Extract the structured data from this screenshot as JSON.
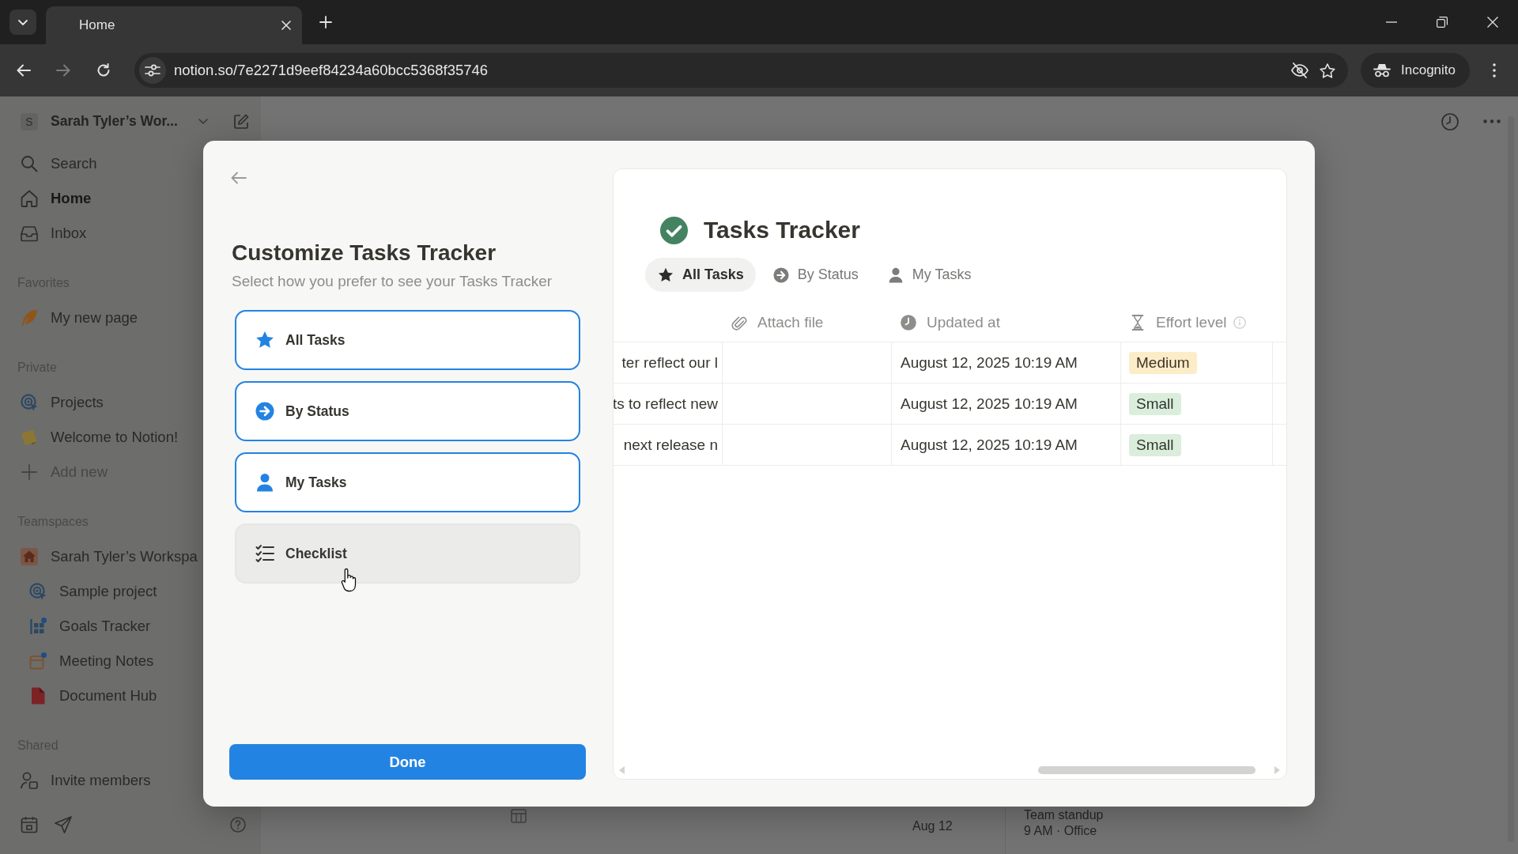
{
  "browser": {
    "tab": {
      "title": "Home"
    },
    "address": "notion.so/7e2271d9eef84234a60bcc5368f35746",
    "profile": "Incognito"
  },
  "sidebar": {
    "workspace": {
      "initial": "S",
      "name": "Sarah Tyler’s Wor..."
    },
    "nav": [
      {
        "label": "Search",
        "kind": "search",
        "selected": false
      },
      {
        "label": "Home",
        "kind": "home",
        "selected": true
      },
      {
        "label": "Inbox",
        "kind": "inbox",
        "selected": false
      }
    ],
    "sections": [
      {
        "title": "Favorites",
        "items": [
          {
            "label": "My new page",
            "kind": "feather"
          }
        ]
      },
      {
        "title": "Private",
        "items": [
          {
            "label": "Projects",
            "kind": "target"
          },
          {
            "label": "Welcome to Notion!",
            "kind": "note"
          },
          {
            "label": "Add new",
            "kind": "add"
          }
        ]
      },
      {
        "title": "Teamspaces",
        "items": [
          {
            "label": "Sarah Tyler’s Workspa",
            "kind": "house",
            "children": [
              {
                "label": "Sample project",
                "kind": "target"
              },
              {
                "label": "Goals Tracker",
                "kind": "grid"
              },
              {
                "label": "Meeting Notes",
                "kind": "calendar"
              },
              {
                "label": "Document Hub",
                "kind": "document"
              }
            ]
          }
        ]
      },
      {
        "title": "Shared",
        "items": [
          {
            "label": "Invite members",
            "kind": "invite"
          }
        ]
      }
    ]
  },
  "page": {
    "date": "Aug 12",
    "event_title": "Team standup",
    "event_detail": "9 AM · Office"
  },
  "modal": {
    "title": "Customize Tasks Tracker",
    "subtitle": "Select how you prefer to see your Tasks Tracker",
    "options": [
      {
        "label": "All Tasks",
        "kind": "star",
        "selected": true,
        "hovered": false
      },
      {
        "label": "By Status",
        "kind": "arrow",
        "selected": true,
        "hovered": false
      },
      {
        "label": "My Tasks",
        "kind": "person",
        "selected": true,
        "hovered": false
      },
      {
        "label": "Checklist",
        "kind": "checklist",
        "selected": false,
        "hovered": true
      }
    ],
    "done_button": "Done",
    "preview": {
      "title": "Tasks Tracker",
      "views": [
        {
          "label": "All Tasks",
          "kind": "star",
          "selected": true
        },
        {
          "label": "By Status",
          "kind": "arrow",
          "selected": false
        },
        {
          "label": "My Tasks",
          "kind": "person",
          "selected": false
        }
      ],
      "columns": [
        {
          "label": "Attach file",
          "kind": "paperclip",
          "info": false
        },
        {
          "label": "Updated at",
          "kind": "clock",
          "info": false
        },
        {
          "label": "Effort level",
          "kind": "hourglass",
          "info": true
        }
      ],
      "rows": [
        {
          "column_1": "ter reflect our l",
          "updated_at": "August 12, 2025 10:19 AM",
          "effort_level": {
            "label": "Medium",
            "color": "#fdecc8"
          }
        },
        {
          "column_1": "ts to reflect new",
          "updated_at": "August 12, 2025 10:19 AM",
          "effort_level": {
            "label": "Small",
            "color": "#dbeddb"
          }
        },
        {
          "column_1": "next release n",
          "updated_at": "August 12, 2025 10:19 AM",
          "effort_level": {
            "label": "Small",
            "color": "#dbeddb"
          }
        }
      ]
    }
  }
}
